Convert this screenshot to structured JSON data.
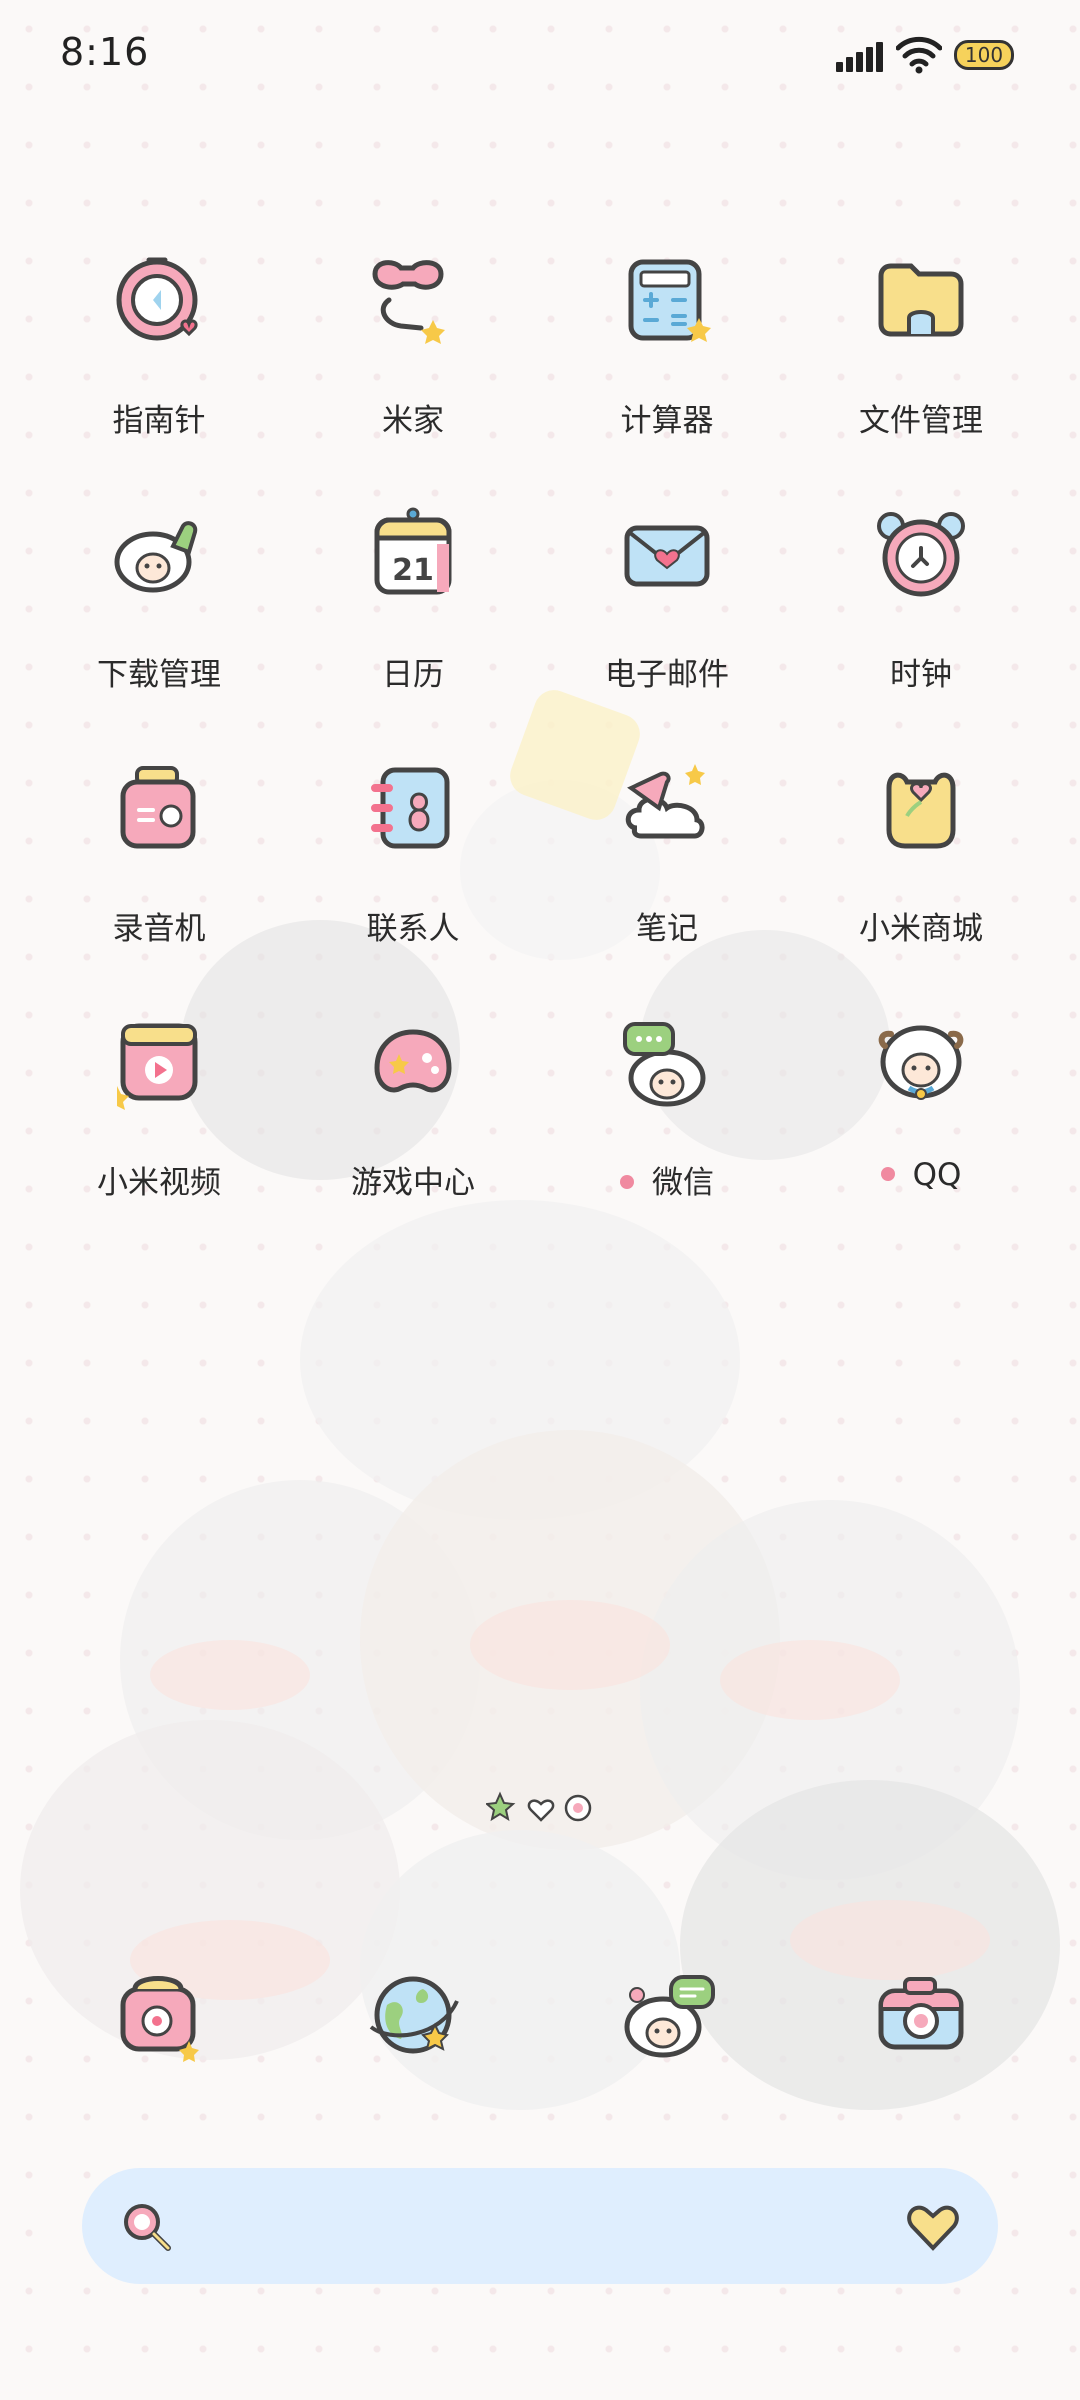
{
  "status_bar": {
    "time": "8:16",
    "battery_level": "100",
    "icons": [
      "signal-icon",
      "wifi-icon",
      "battery-icon"
    ]
  },
  "apps": [
    {
      "label": "指南针",
      "icon": "compass-icon"
    },
    {
      "label": "米家",
      "icon": "mi-home-icon"
    },
    {
      "label": "计算器",
      "icon": "calculator-icon"
    },
    {
      "label": "文件管理",
      "icon": "file-manager-icon"
    },
    {
      "label": "下载管理",
      "icon": "download-manager-icon"
    },
    {
      "label": "日历",
      "icon": "calendar-icon",
      "icon_text": "21"
    },
    {
      "label": "电子邮件",
      "icon": "email-icon"
    },
    {
      "label": "时钟",
      "icon": "clock-icon"
    },
    {
      "label": "录音机",
      "icon": "recorder-icon"
    },
    {
      "label": "联系人",
      "icon": "contacts-icon"
    },
    {
      "label": "笔记",
      "icon": "notes-icon"
    },
    {
      "label": "小米商城",
      "icon": "mi-store-icon"
    },
    {
      "label": "小米视频",
      "icon": "mi-video-icon"
    },
    {
      "label": "游戏中心",
      "icon": "game-center-icon"
    },
    {
      "label": "微信",
      "icon": "wechat-icon",
      "new_dot": true
    },
    {
      "label": "QQ",
      "icon": "qq-icon",
      "new_dot": true
    }
  ],
  "pager": {
    "icons": [
      "star-page-icon",
      "heart-page-icon",
      "flower-page-icon"
    ]
  },
  "dock": [
    {
      "icon": "phone-icon"
    },
    {
      "icon": "browser-icon"
    },
    {
      "icon": "messages-icon"
    },
    {
      "icon": "camera-icon"
    }
  ],
  "search_bar": {
    "icons": [
      "search-icon",
      "heart-icon"
    ]
  },
  "colors": {
    "pink": "#f4a7b9",
    "yellow": "#f8df8b",
    "blue": "#bfe2f6",
    "outline": "#444444",
    "search_bg": "#dfeefe"
  }
}
